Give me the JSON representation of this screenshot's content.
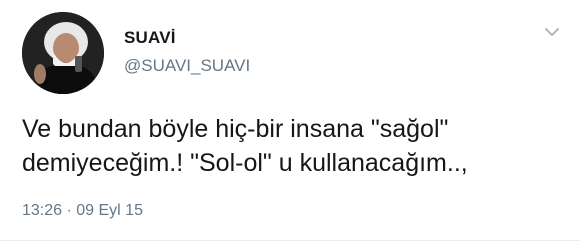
{
  "tweet": {
    "author": {
      "display_name": "SUAVİ",
      "handle": "@SUAVI_SUAVI"
    },
    "text": "Ve bundan böyle hiç-bir insana \"sağol\"\ndemiyeceğim.! \"Sol-ol\" u kullanacağım..,",
    "timestamp": "13:26 · 09 Eyl 15"
  },
  "icons": {
    "menu": "chevron-down-icon"
  },
  "colors": {
    "name": "#14171a",
    "secondary_text": "#657786",
    "background": "#ffffff"
  }
}
